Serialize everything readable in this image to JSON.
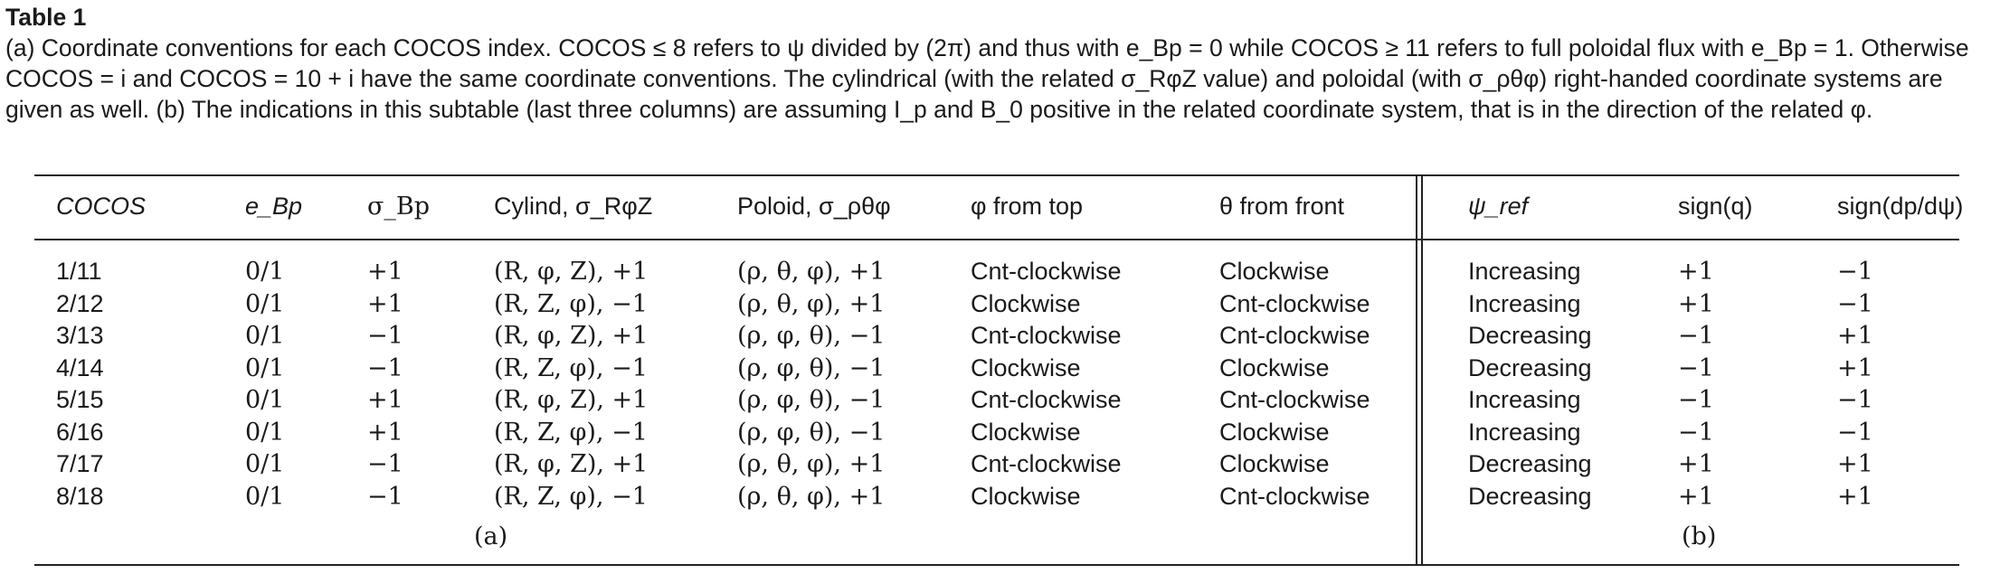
{
  "caption": {
    "label": "Table 1",
    "text": "(a) Coordinate conventions for each COCOS index. COCOS ≤ 8 refers to ψ divided by (2π) and thus with e_Bp = 0 while COCOS ≥ 11 refers to full poloidal flux with e_Bp = 1. Otherwise COCOS = i and COCOS = 10 + i have the same coordinate conventions. The cylindrical (with the related σ_RφZ value) and poloidal (with σ_ρθφ) right-handed coordinate systems are given as well. (b) The indications in this subtable (last three columns) are assuming I_p and B_0 positive in the related coordinate system, that is in the direction of the related φ."
  },
  "table": {
    "headers": [
      "COCOS",
      "e_Bp",
      "σ_Bp",
      "Cylind, σ_RφZ",
      "Poloid, σ_ρθφ",
      "φ from top",
      "θ from front",
      "ψ_ref",
      "sign(q)",
      "sign(dp/dψ)"
    ],
    "rows": [
      [
        "1/11",
        "0/1",
        "+1",
        "(R, φ, Z), +1",
        "(ρ, θ, φ), +1",
        "Cnt-clockwise",
        "Clockwise",
        "Increasing",
        "+1",
        "−1"
      ],
      [
        "2/12",
        "0/1",
        "+1",
        "(R, Z, φ), −1",
        "(ρ, θ, φ), +1",
        "Clockwise",
        "Cnt-clockwise",
        "Increasing",
        "+1",
        "−1"
      ],
      [
        "3/13",
        "0/1",
        "−1",
        "(R, φ, Z), +1",
        "(ρ, φ, θ), −1",
        "Cnt-clockwise",
        "Cnt-clockwise",
        "Decreasing",
        "−1",
        "+1"
      ],
      [
        "4/14",
        "0/1",
        "−1",
        "(R, Z, φ), −1",
        "(ρ, φ, θ), −1",
        "Clockwise",
        "Clockwise",
        "Decreasing",
        "−1",
        "+1"
      ],
      [
        "5/15",
        "0/1",
        "+1",
        "(R, φ, Z), +1",
        "(ρ, φ, θ), −1",
        "Cnt-clockwise",
        "Cnt-clockwise",
        "Increasing",
        "−1",
        "−1"
      ],
      [
        "6/16",
        "0/1",
        "+1",
        "(R, Z, φ), −1",
        "(ρ, φ, θ), −1",
        "Clockwise",
        "Clockwise",
        "Increasing",
        "−1",
        "−1"
      ],
      [
        "7/17",
        "0/1",
        "−1",
        "(R, φ, Z), +1",
        "(ρ, θ, φ), +1",
        "Cnt-clockwise",
        "Clockwise",
        "Decreasing",
        "+1",
        "+1"
      ],
      [
        "8/18",
        "0/1",
        "−1",
        "(R, Z, φ), −1",
        "(ρ, θ, φ), +1",
        "Clockwise",
        "Cnt-clockwise",
        "Decreasing",
        "+1",
        "+1"
      ]
    ],
    "sublabel_a": "(a)",
    "sublabel_b": "(b)"
  }
}
